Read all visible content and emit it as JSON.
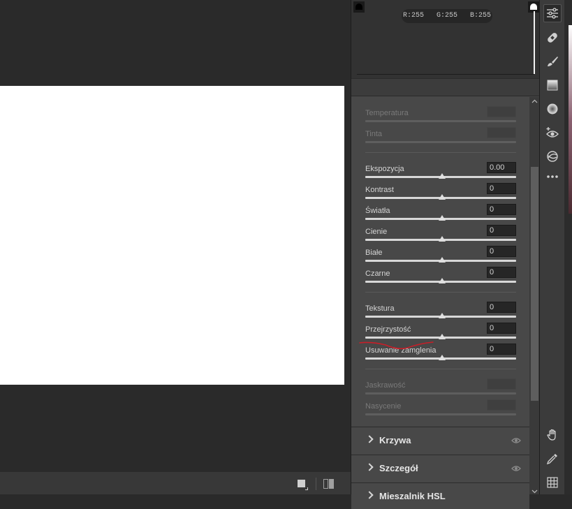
{
  "canvas": {
    "image_background": "#ffffff"
  },
  "histogram": {
    "rgb_readout": "R:255   G:255   B:255"
  },
  "basic_panel": {
    "white_balance": [
      {
        "label": "Temperatura",
        "value": "",
        "enabled": false,
        "position": 0.5
      },
      {
        "label": "Tinta",
        "value": "",
        "enabled": false,
        "position": 0.5
      }
    ],
    "tone": [
      {
        "label": "Ekspozycja",
        "value": "0.00",
        "enabled": true,
        "position": 0.5
      },
      {
        "label": "Kontrast",
        "value": "0",
        "enabled": true,
        "position": 0.5
      },
      {
        "label": "Światła",
        "value": "0",
        "enabled": true,
        "position": 0.5
      },
      {
        "label": "Cienie",
        "value": "0",
        "enabled": true,
        "position": 0.5
      },
      {
        "label": "Białe",
        "value": "0",
        "enabled": true,
        "position": 0.5
      },
      {
        "label": "Czarne",
        "value": "0",
        "enabled": true,
        "position": 0.5
      }
    ],
    "presence": [
      {
        "label": "Tekstura",
        "value": "0",
        "enabled": true,
        "position": 0.5
      },
      {
        "label": "Przejrzystość",
        "value": "0",
        "enabled": true,
        "position": 0.5
      },
      {
        "label": "Usuwanie zamglenia",
        "value": "0",
        "enabled": true,
        "position": 0.5
      }
    ],
    "color": [
      {
        "label": "Jaskrawość",
        "value": "",
        "enabled": false,
        "position": 0.5
      },
      {
        "label": "Nasycenie",
        "value": "",
        "enabled": false,
        "position": 0.5
      }
    ]
  },
  "sections": [
    {
      "title": "Krzywa"
    },
    {
      "title": "Szczegół"
    },
    {
      "title": "Mieszalnik HSL"
    }
  ],
  "toolbar": {
    "tools": [
      {
        "name": "edit-sliders-icon",
        "active": true
      },
      {
        "name": "healing-icon",
        "active": false
      },
      {
        "name": "brush-icon",
        "active": false
      },
      {
        "name": "linear-gradient-icon",
        "active": false
      },
      {
        "name": "radial-gradient-icon",
        "active": false
      },
      {
        "name": "red-eye-icon",
        "active": false
      },
      {
        "name": "presets-icon",
        "active": false
      },
      {
        "name": "more-icon",
        "active": false
      },
      {
        "name": "hand-icon",
        "active": false
      },
      {
        "name": "eyedropper-icon",
        "active": false
      },
      {
        "name": "grid-icon",
        "active": false
      }
    ]
  },
  "colors": {
    "panel_bg": "#484848",
    "annotation_red": "#c81e28"
  }
}
